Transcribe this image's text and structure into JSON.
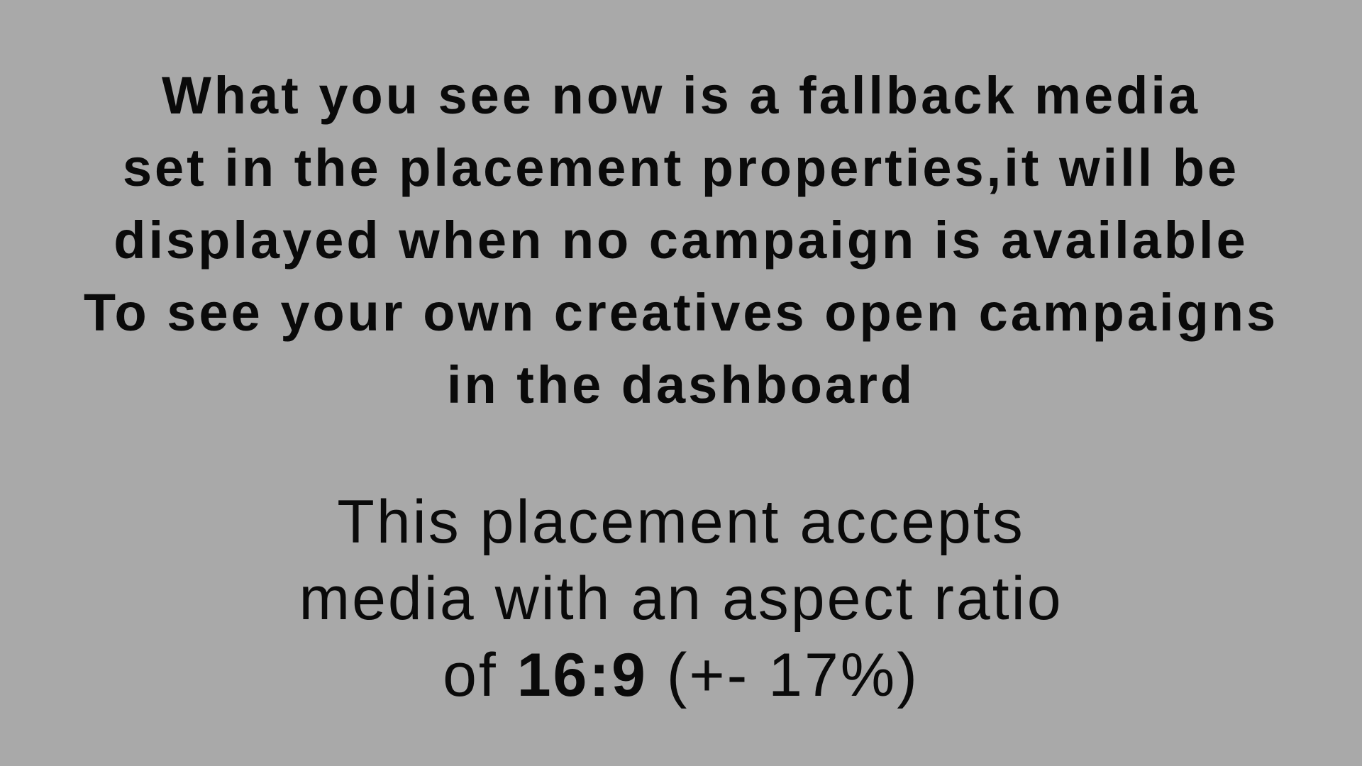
{
  "fallback_message": {
    "lines": [
      "What you see now is a fallback media",
      "set in the placement properties,it will be",
      "displayed when no campaign is available",
      "To see your own creatives open campaigns",
      "in the dashboard"
    ]
  },
  "aspect_message": {
    "line1": "This placement accepts",
    "line2": "media with an aspect ratio",
    "line3_prefix": "of ",
    "ratio": "16:9",
    "line3_suffix": " (+- 17%)"
  },
  "colors": {
    "background": "#a9a9a9",
    "text": "#0a0a0a"
  }
}
